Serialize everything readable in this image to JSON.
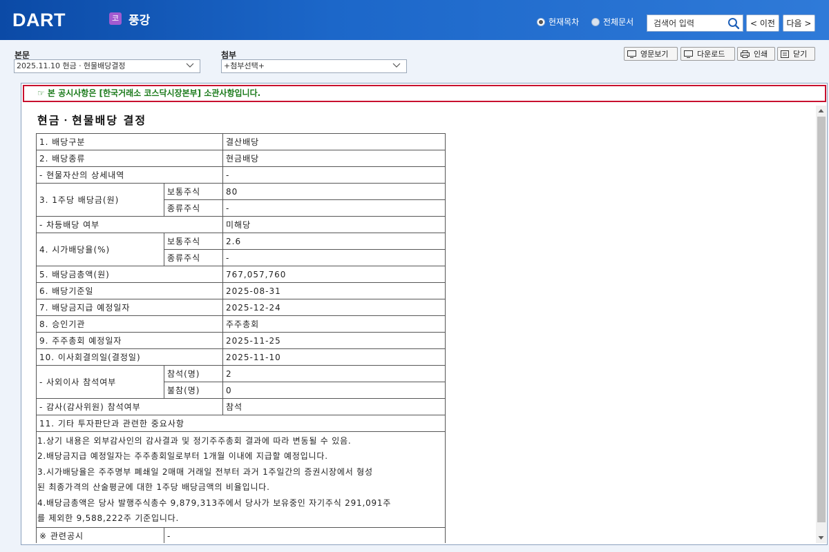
{
  "header": {
    "logo": "DART",
    "corp_badge": "코",
    "corp_name": "풍강",
    "radio_current": "현재목차",
    "radio_all": "전체문서",
    "search_placeholder": "검색어 입력",
    "prev_label": "< 이전",
    "next_label": "다음 >"
  },
  "toolbar": {
    "main_label": "본문",
    "main_select": "2025.11.10  현금ㆍ현물배당결정",
    "attach_label": "첨부",
    "attach_select": "+첨부선택+",
    "english_label": "영문보기",
    "download_label": "다운로드",
    "print_label": "인쇄",
    "close_label": "닫기"
  },
  "notice": "☞ 본 공시사항은 [한국거래소 코스닥시장본부] 소관사항입니다.",
  "document": {
    "title": "현금ㆍ현물배당 결정",
    "rows": {
      "r1_label": "1. 배당구분",
      "r1_value": "결산배당",
      "r2_label": "2. 배당종류",
      "r2_value": "현금배당",
      "r3_label": "- 현물자산의 상세내역",
      "r3_value": "-",
      "r4_label": "3. 1주당 배당금(원)",
      "r4_common": "보통주식",
      "r4_common_value": "80",
      "r4_pref": "종류주식",
      "r4_pref_value": "-",
      "r5_label": "- 차등배당 여부",
      "r5_value": "미해당",
      "r6_label": "4. 시가배당율(%)",
      "r6_common": "보통주식",
      "r6_common_value": "2.6",
      "r6_pref": "종류주식",
      "r6_pref_value": "-",
      "r7_label": "5. 배당금총액(원)",
      "r7_value": "767,057,760",
      "r8_label": "6. 배당기준일",
      "r8_value": "2025-08-31",
      "r9_label": "7. 배당금지급 예정일자",
      "r9_value": "2025-12-24",
      "r10_label": "8. 승인기관",
      "r10_value": "주주총회",
      "r11_label": "9. 주주총회 예정일자",
      "r11_value": "2025-11-25",
      "r12_label": "10. 이사회결의일(결정일)",
      "r12_value": "2025-11-10",
      "r13_label": "- 사외이사 참석여부",
      "r13_present": "참석(명)",
      "r13_present_value": "2",
      "r13_absent": "불참(명)",
      "r13_absent_value": "0",
      "r14_label": "- 감사(감사위원) 참석여부",
      "r14_value": "참석",
      "r15_label": "11. 기타 투자판단과 관련한 중요사항",
      "related_label": "※ 관련공시",
      "related_value": "-"
    },
    "notes": [
      "1.상기 내용은 외부감사인의 감사결과 및 정기주주총회 결과에 따라 변동될 수 있음.",
      "2.배당금지급 예정일자는 주주총회일로부터 1개월 이내에 지급할 예정입니다.",
      "3.시가배당율은 주주명부 폐쇄일 2매매 거래일 전부터 과거 1주일간의 증권시장에서 형성",
      "된 최종가격의 산술평균에 대한 1주당 배당금액의 비율입니다.",
      "4.배당금총액은 당사 발행주식총수 9,879,313주에서 당사가 보유중인 자기주식 291,091주",
      "를 제외한 9,588,222주 기준입니다."
    ]
  },
  "colors": {
    "header_blue": "#1c67c9",
    "notice_border": "#c8102e",
    "notice_text": "#1a7a1a",
    "corp_badge": "#a25bd0"
  }
}
